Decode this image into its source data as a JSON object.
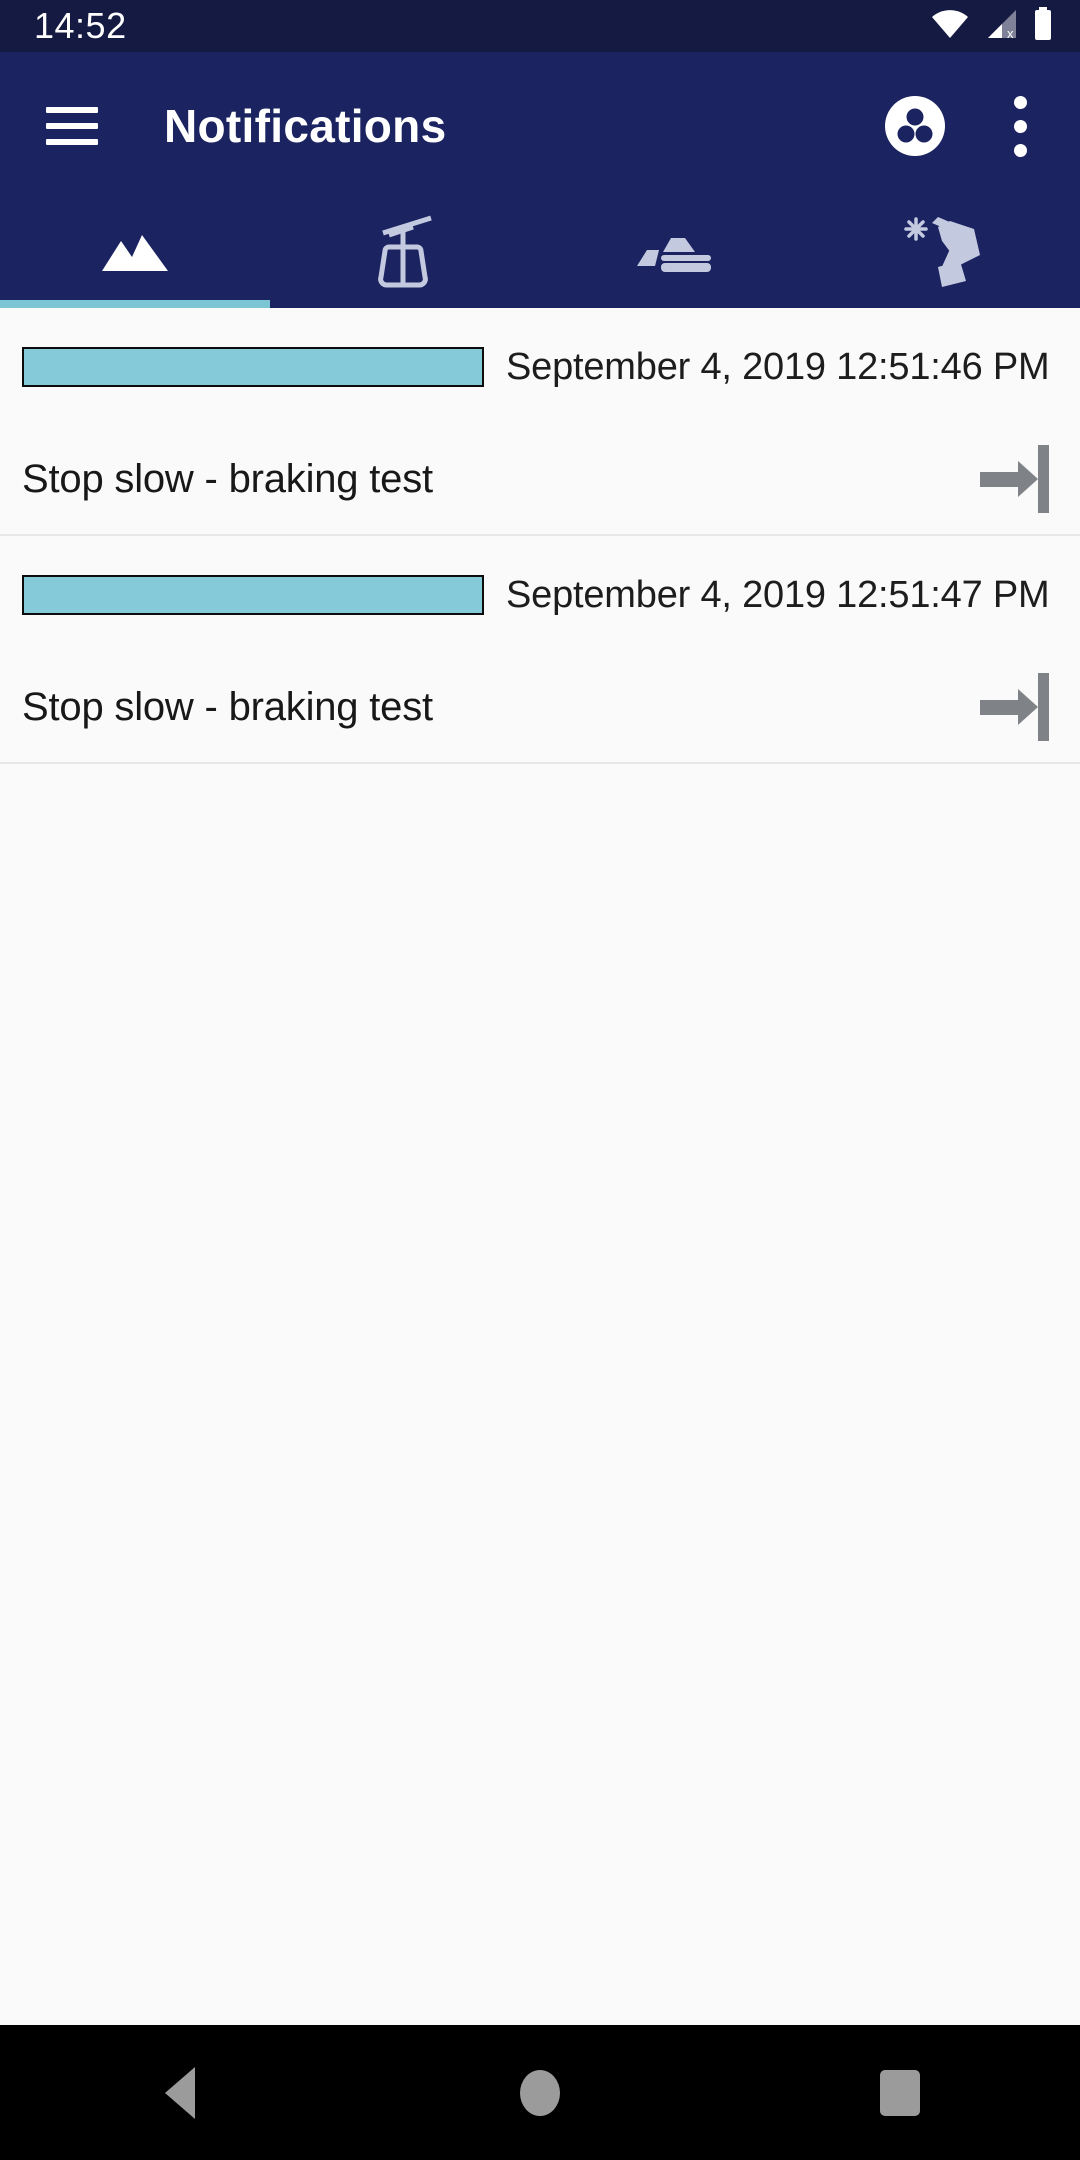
{
  "status_bar": {
    "time": "14:52",
    "icons": [
      "wifi-icon",
      "cellular-signal-off-icon",
      "battery-icon"
    ]
  },
  "app_bar": {
    "menu_icon": "hamburger-menu-icon",
    "title": "Notifications",
    "actions": [
      {
        "name": "filter-grain-icon",
        "label": "Filter"
      },
      {
        "name": "overflow-menu-icon",
        "label": "More options"
      }
    ]
  },
  "tabs": [
    {
      "id": "slopes",
      "icon": "mountain-icon",
      "label": "Slopes",
      "active": true
    },
    {
      "id": "lifts",
      "icon": "gondola-lift-icon",
      "label": "Lifts",
      "active": false
    },
    {
      "id": "groomers",
      "icon": "snow-groomer-icon",
      "label": "Snow groomers",
      "active": false
    },
    {
      "id": "snow-guns",
      "icon": "snow-cannon-icon",
      "label": "Snow guns",
      "active": false
    }
  ],
  "colors": {
    "app_bar": "#1b2360",
    "status_bar": "#141a42",
    "tab_indicator": "#7cc5d4",
    "level_bar": "#85cad8",
    "content_bg": "#fafafa",
    "nav_bar": "#000000",
    "action_icon": "#7f8287"
  },
  "list": {
    "items": [
      {
        "date": "September 4, 2019 12:51:46 PM",
        "title": "Stop slow - braking test",
        "level_bar": true,
        "action_icon": "arrow-to-end-icon"
      },
      {
        "date": "September 4, 2019 12:51:47 PM",
        "title": "Stop slow - braking test",
        "level_bar": true,
        "action_icon": "arrow-to-end-icon"
      }
    ]
  },
  "nav_bar": {
    "back": "back-triangle-icon",
    "home": "home-circle-icon",
    "recents": "recents-square-icon"
  }
}
